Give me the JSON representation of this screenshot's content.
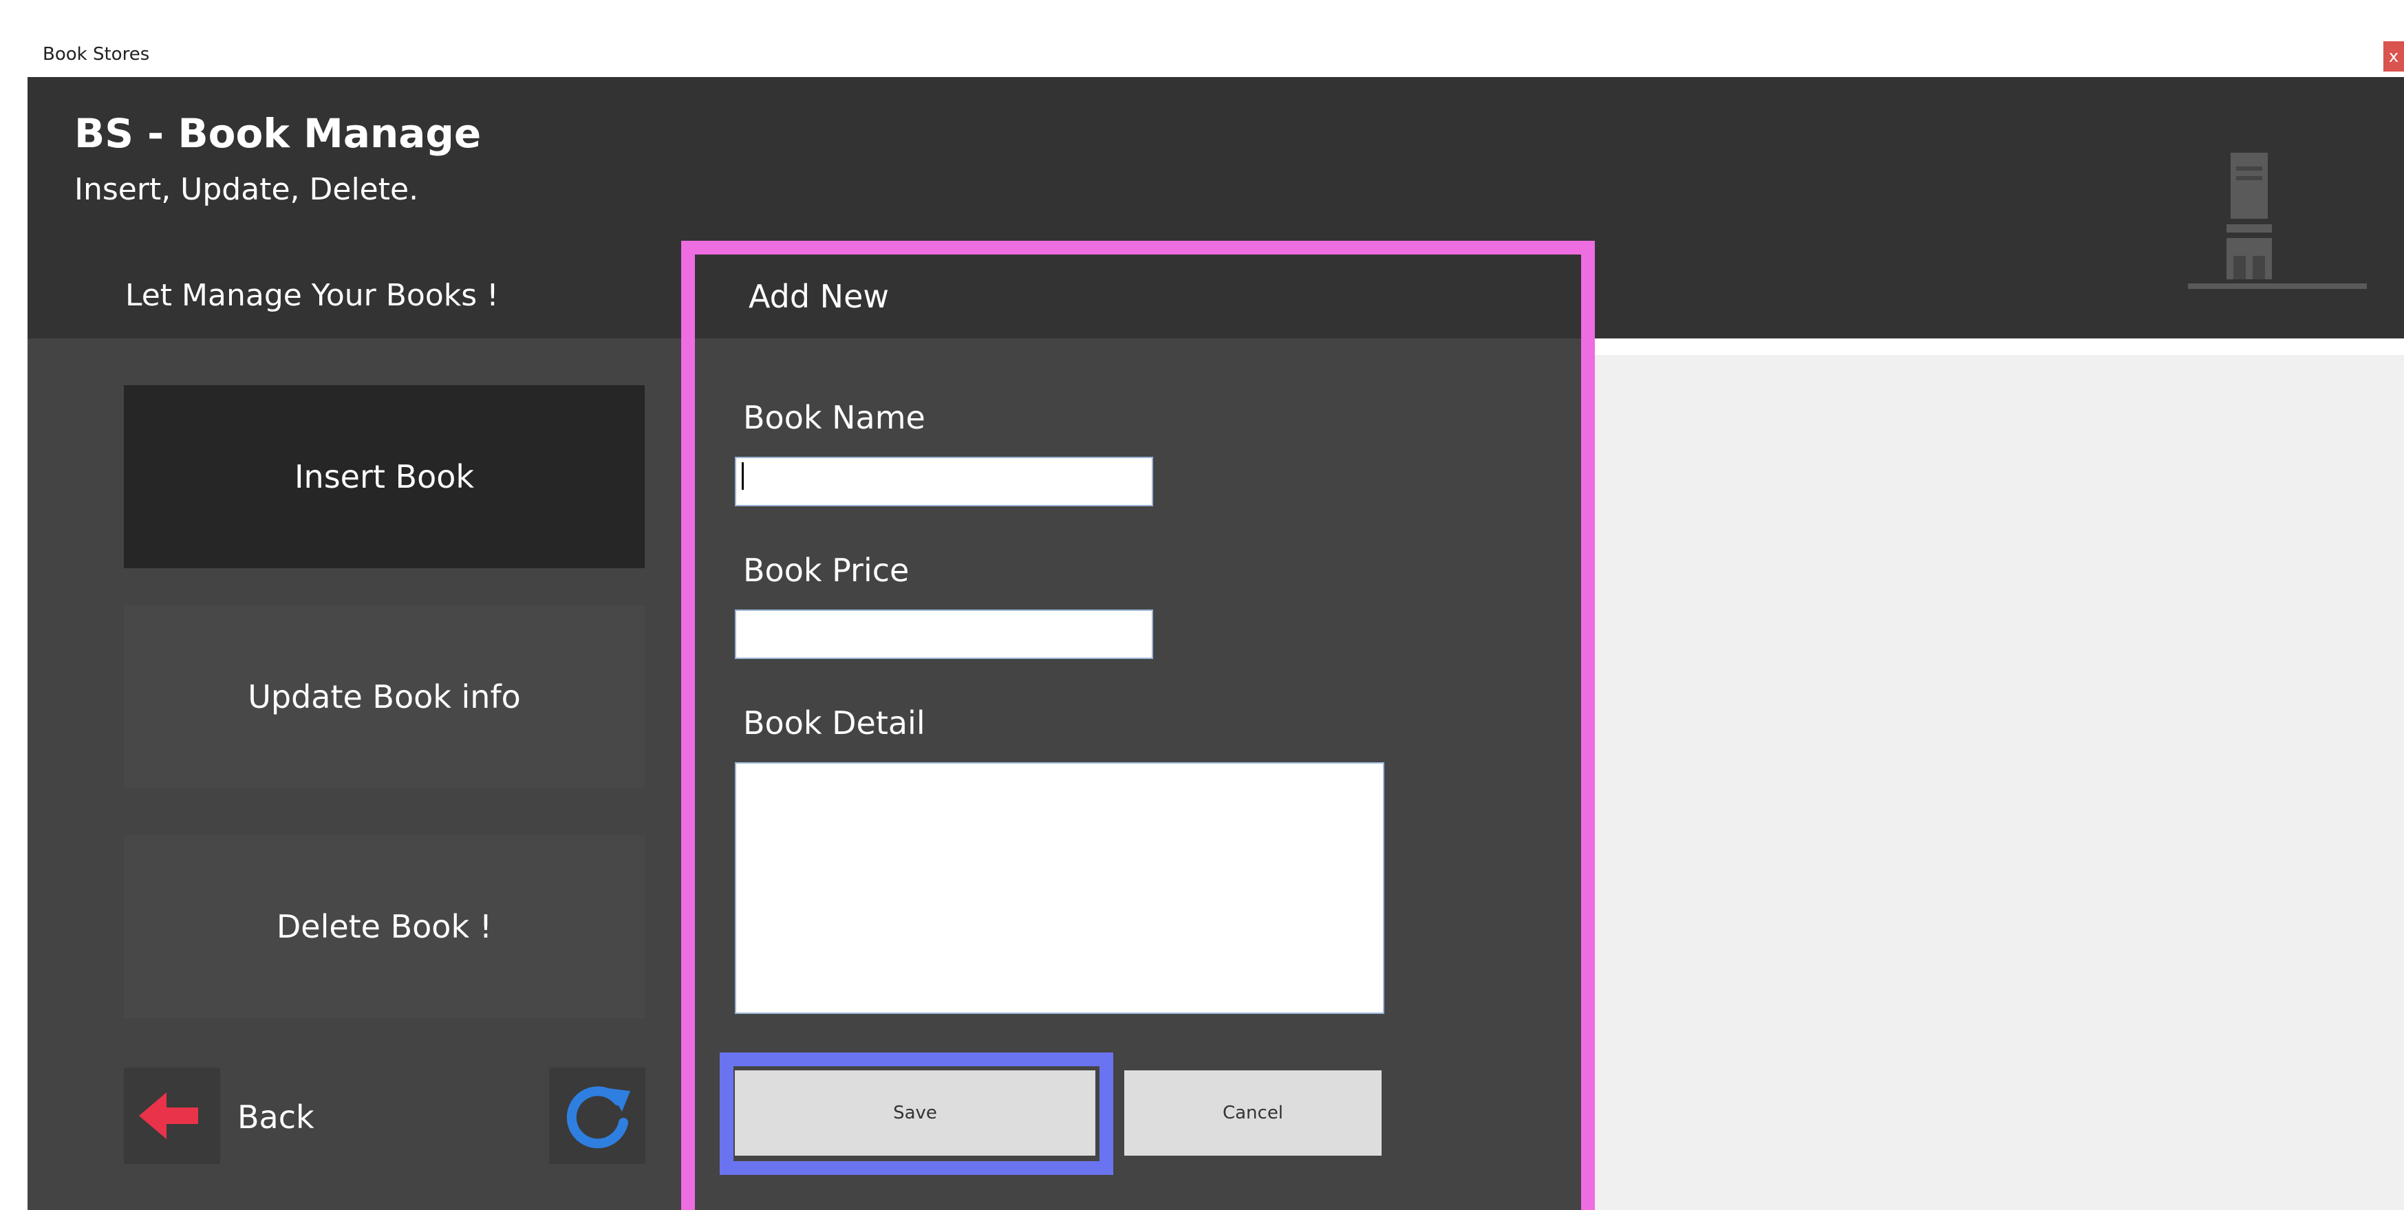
{
  "window": {
    "title": "Book Stores",
    "close_label": "x"
  },
  "header": {
    "title": "BS - Book Manage",
    "subtitle": "Insert, Update, Delete.",
    "logo_icon": "bookstore-icon"
  },
  "sidebar": {
    "heading": "Let Manage Your Books !",
    "items": [
      {
        "label": "Insert Book",
        "active": true
      },
      {
        "label": "Update Book info",
        "active": false
      },
      {
        "label": "Delete Book !",
        "active": false
      }
    ],
    "back_label": "Back",
    "back_icon": "arrow-left-icon",
    "refresh_icon": "refresh-icon"
  },
  "form": {
    "heading": "Add New",
    "fields": {
      "book_name": {
        "label": "Book Name",
        "value": ""
      },
      "book_price": {
        "label": "Book Price",
        "value": ""
      },
      "book_detail": {
        "label": "Book Detail",
        "value": ""
      }
    },
    "save_label": "Save",
    "cancel_label": "Cancel"
  },
  "colors": {
    "header_bg": "#333333",
    "panel_bg": "#444444",
    "active_item_bg": "#262626",
    "form_highlight": "#ee6de0",
    "save_highlight": "#6b74f0",
    "back_arrow": "#e8334a",
    "refresh_icon": "#2f7fe0",
    "close_button": "#d9534f"
  }
}
